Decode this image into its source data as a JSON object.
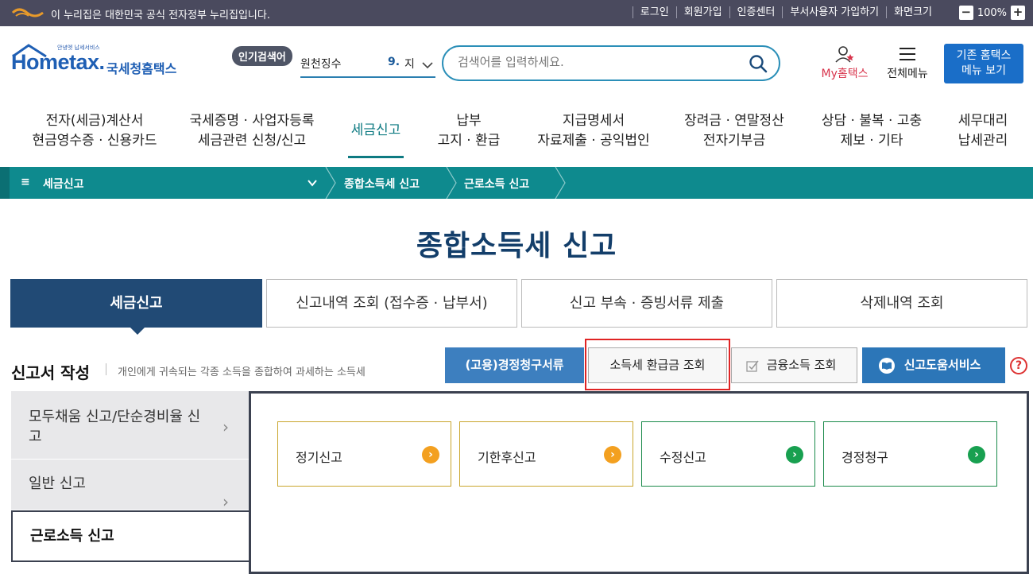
{
  "govbar": {
    "notice": "이 누리집은 대한민국 공식 전자정부 누리집입니다.",
    "links": [
      "로그인",
      "회원가입",
      "인증센터",
      "부서사용자 가입하기",
      "화면크기"
    ],
    "zoom_minus": "−",
    "zoom_level": "100%",
    "zoom_plus": "+"
  },
  "header": {
    "logo_small": "안녕엣 납세서비스",
    "logo_main": "Hometax.",
    "logo_kr": "국세청홈택스",
    "popular_badge": "인기검색어",
    "popular_term": "원천징수",
    "popular_rank": "9.",
    "popular_next": "지",
    "search_placeholder": "검색어를 입력하세요.",
    "my_hometax": "My홈택스",
    "all_menu": "전체메뉴",
    "old_hometax_line1": "기존 홈택스",
    "old_hometax_line2": "메뉴 보기"
  },
  "gnb": [
    {
      "line1": "전자(세금)계산서",
      "line2": "현금영수증 · 신용카드"
    },
    {
      "line1": "국세증명 · 사업자등록",
      "line2": "세금관련 신청/신고"
    },
    {
      "line1": "세금신고",
      "line2": ""
    },
    {
      "line1": "납부",
      "line2": "고지 · 환급"
    },
    {
      "line1": "지급명세서",
      "line2": "자료제출 · 공익법인"
    },
    {
      "line1": "장려금 · 연말정산",
      "line2": "전자기부금"
    },
    {
      "line1": "상담 · 불복 · 고충",
      "line2": "제보 · 기타"
    },
    {
      "line1": "세무대리",
      "line2": "납세관리"
    }
  ],
  "breadcrumb": {
    "first": "세금신고",
    "second": "종합소득세 신고",
    "third": "근로소득 신고"
  },
  "page_title": "종합소득세 신고",
  "tabs": [
    "세금신고",
    "신고내역 조회 (접수증 · 납부서)",
    "신고 부속 · 증빙서류 제출",
    "삭제내역 조회"
  ],
  "section": {
    "title": "신고서 작성",
    "desc": "개인에게 귀속되는 각종 소득을 종합하여 과세하는 소득세"
  },
  "actions": {
    "claim_docs": "(고용)경정청구서류",
    "refund_lookup": "소득세 환급금 조회",
    "finance_income": "금융소득 조회",
    "help_service": "신고도움서비스"
  },
  "lnb": [
    {
      "label": "모두채움 신고/단순경비율 신고"
    },
    {
      "label": "일반 신고"
    },
    {
      "label": "근로소득 신고"
    }
  ],
  "cards": [
    {
      "label": "정기신고"
    },
    {
      "label": "기한후신고"
    },
    {
      "label": "수정신고"
    },
    {
      "label": "경정청구"
    }
  ],
  "colors": {
    "teal": "#0e8a8e",
    "navy": "#214a75",
    "highlight": "#e02424"
  }
}
